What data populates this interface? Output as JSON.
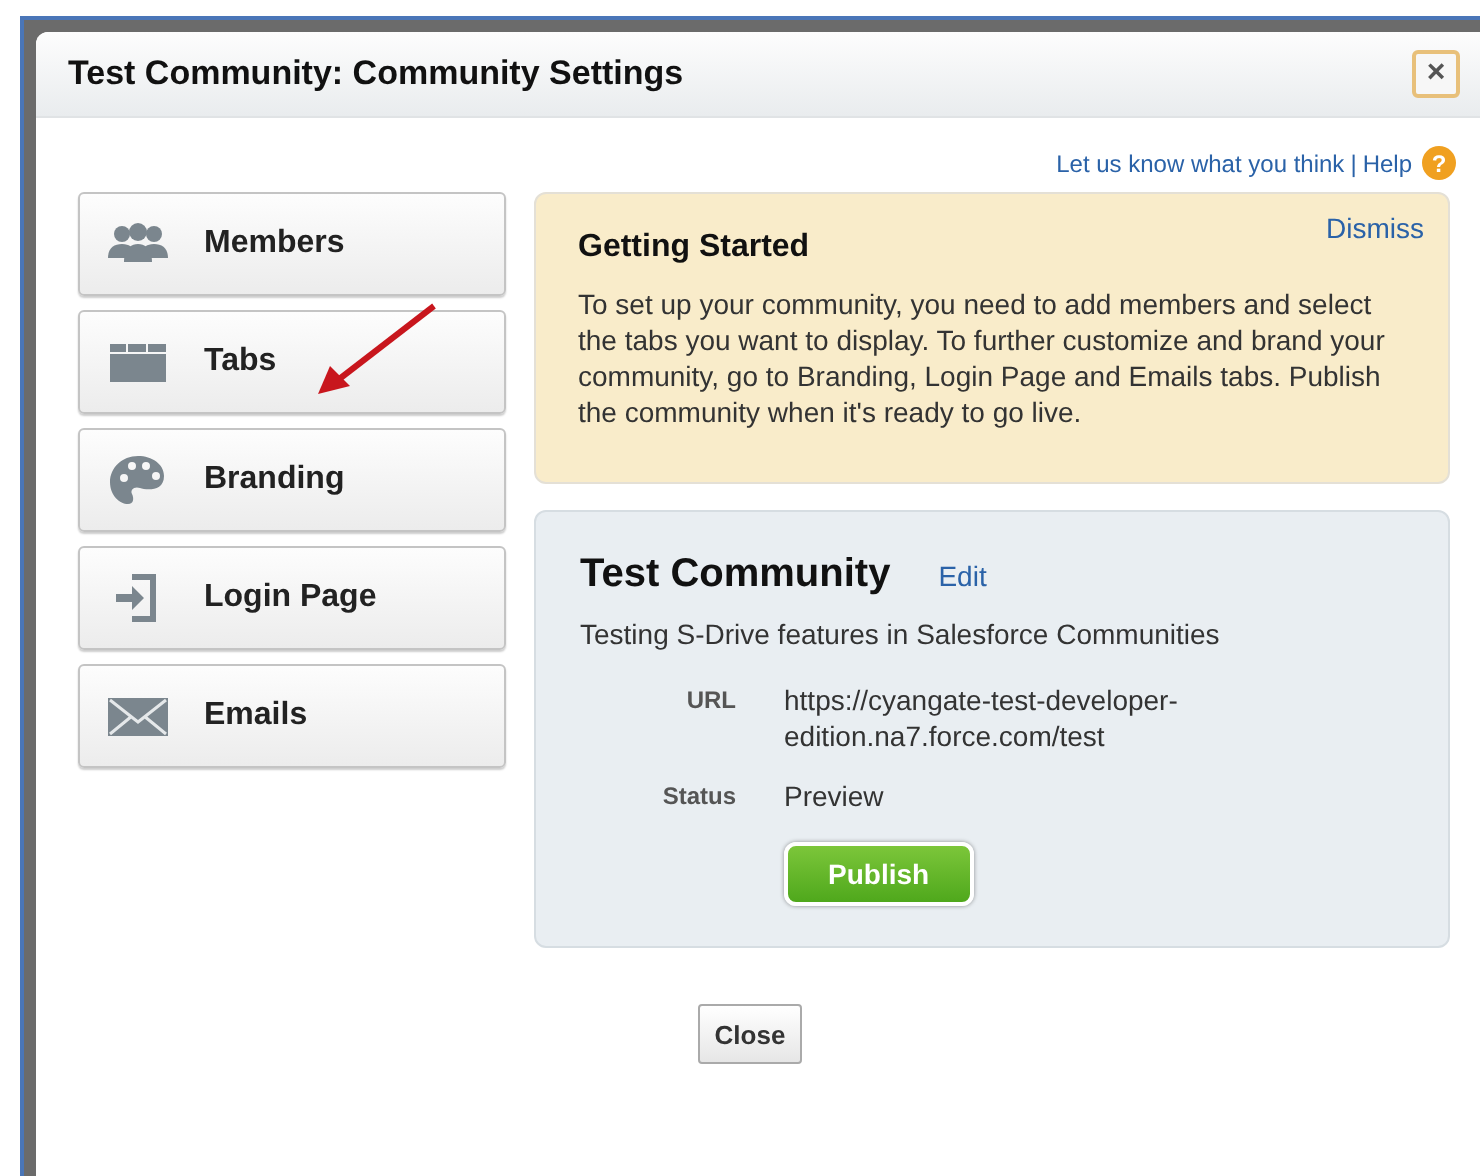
{
  "dialog": {
    "title": "Test Community: Community Settings",
    "close_label": "×"
  },
  "links": {
    "feedback": "Let us know what you think",
    "separator": "|",
    "help": "Help",
    "help_icon": "?"
  },
  "nav": [
    {
      "label": "Members",
      "kind": "members"
    },
    {
      "label": "Tabs",
      "kind": "tabs"
    },
    {
      "label": "Branding",
      "kind": "branding"
    },
    {
      "label": "Login Page",
      "kind": "login"
    },
    {
      "label": "Emails",
      "kind": "emails"
    }
  ],
  "getting_started": {
    "title": "Getting Started",
    "dismiss": "Dismiss",
    "text": "To set up your community, you need to add members and select the tabs you want to display. To further customize and brand your community, go to Branding, Login Page and Emails tabs. Publish the community when it's ready to go live."
  },
  "community": {
    "name": "Test Community",
    "edit": "Edit",
    "description": "Testing S-Drive features in Salesforce Communities",
    "fields": [
      {
        "label": "URL",
        "value": "https://cyangate-test-developer-edition.na7.force.com/test"
      },
      {
        "label": "Status",
        "value": "Preview"
      }
    ],
    "publish": "Publish"
  },
  "close_button": "Close"
}
